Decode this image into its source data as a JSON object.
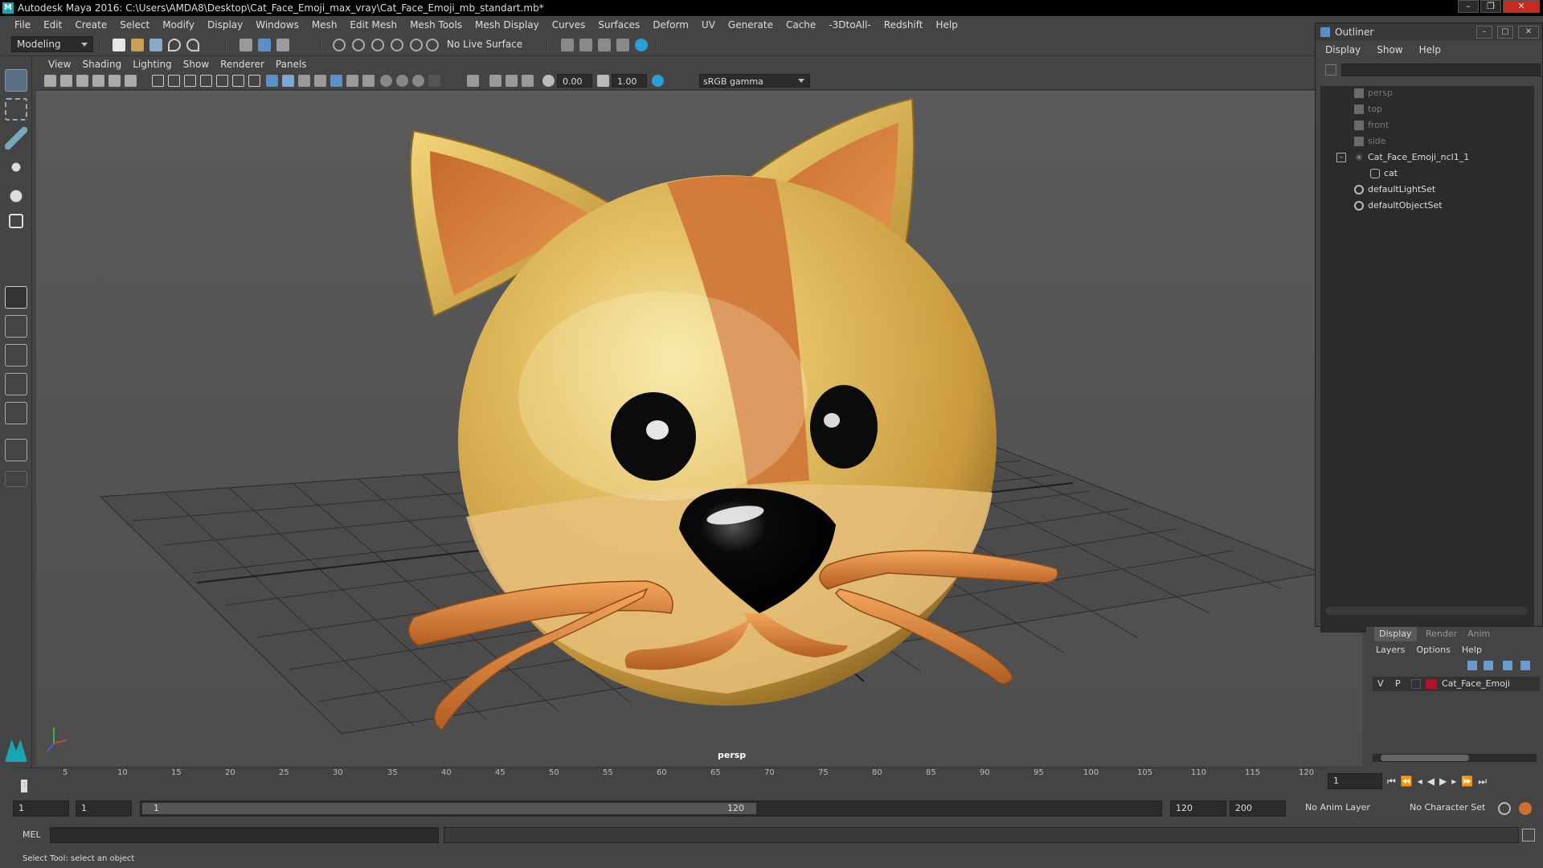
{
  "window": {
    "title": "Autodesk Maya 2016: C:\\Users\\AMDA8\\Desktop\\Cat_Face_Emoji_max_vray\\Cat_Face_Emoji_mb_standart.mb*"
  },
  "menubar": {
    "items": [
      "File",
      "Edit",
      "Create",
      "Select",
      "Modify",
      "Display",
      "Windows",
      "Mesh",
      "Edit Mesh",
      "Mesh Tools",
      "Mesh Display",
      "Curves",
      "Surfaces",
      "Deform",
      "UV",
      "Generate",
      "Cache",
      "-3DtoAll-",
      "Redshift",
      "Help"
    ]
  },
  "statusline": {
    "mode": "Modeling",
    "live_surface": "No Live Surface"
  },
  "viewport": {
    "menu": [
      "View",
      "Shading",
      "Lighting",
      "Show",
      "Renderer",
      "Panels"
    ],
    "exposure": "0.00",
    "gamma_value": "1.00",
    "color_space": "sRGB gamma",
    "camera_label": "persp"
  },
  "outliner": {
    "title": "Outliner",
    "menu": [
      "Display",
      "Show",
      "Help"
    ],
    "items": [
      {
        "label": "persp",
        "type": "camera",
        "dim": true
      },
      {
        "label": "top",
        "type": "camera",
        "dim": true
      },
      {
        "label": "front",
        "type": "camera",
        "dim": true
      },
      {
        "label": "side",
        "type": "camera",
        "dim": true
      },
      {
        "label": "Cat_Face_Emoji_ncl1_1",
        "type": "group"
      },
      {
        "label": "cat",
        "type": "mesh"
      },
      {
        "label": "defaultLightSet",
        "type": "set"
      },
      {
        "label": "defaultObjectSet",
        "type": "set"
      }
    ]
  },
  "layer_editor": {
    "tabs": [
      "Display",
      "Render",
      "Anim"
    ],
    "menu": [
      "Layers",
      "Options",
      "Help"
    ],
    "layer": {
      "v": "V",
      "p": "P",
      "name": "Cat_Face_Emoji",
      "color": "#b0142c"
    }
  },
  "timeslider": {
    "ticks": [
      "1",
      "5",
      "10",
      "15",
      "20",
      "25",
      "30",
      "35",
      "40",
      "45",
      "50",
      "55",
      "60",
      "65",
      "70",
      "75",
      "80",
      "85",
      "90",
      "95",
      "100",
      "105",
      "110",
      "115",
      "120"
    ],
    "current_frame": "1"
  },
  "range": {
    "start": "1",
    "playback_start": "1",
    "range_start": "1",
    "range_end": "120",
    "playback_end": "120",
    "end": "200",
    "anim_layer": "No Anim Layer",
    "character_set": "No Character Set"
  },
  "cmdline": {
    "label": "MEL"
  },
  "helpline": {
    "text": "Select Tool: select an object"
  },
  "colors": {
    "accent": "#5a6e84",
    "cat_yellow": "#d9a94a",
    "cat_orange": "#d2773a",
    "layer_red": "#b0142c"
  }
}
